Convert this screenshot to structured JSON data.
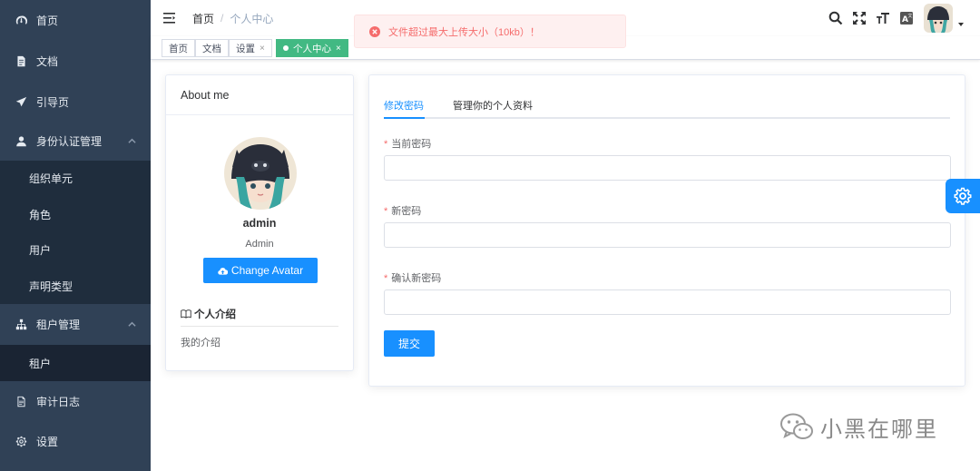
{
  "sidebar": {
    "items": [
      {
        "label": "首页",
        "icon": "dashboard-icon"
      },
      {
        "label": "文档",
        "icon": "document-icon"
      },
      {
        "label": "引导页",
        "icon": "guide-icon"
      },
      {
        "label": "身份认证管理",
        "icon": "user-icon",
        "expanded": true,
        "children": [
          "组织单元",
          "角色",
          "用户",
          "声明类型"
        ]
      },
      {
        "label": "租户管理",
        "icon": "tree-icon",
        "expanded": true,
        "children": [
          "租户"
        ]
      },
      {
        "label": "审计日志",
        "icon": "log-icon"
      },
      {
        "label": "设置",
        "icon": "gear-icon"
      }
    ]
  },
  "navbar": {
    "breadcrumb": [
      "首页",
      "个人中心"
    ],
    "icons": [
      "search-icon",
      "fullscreen-icon",
      "font-size-icon",
      "language-icon"
    ]
  },
  "tags": {
    "items": [
      {
        "label": "首页",
        "closable": false
      },
      {
        "label": "文档",
        "closable": false
      },
      {
        "label": "设置",
        "closable": true
      },
      {
        "label": "个人中心",
        "closable": true,
        "active": true
      }
    ],
    "close_symbol": "×",
    "active_color": "#42b983"
  },
  "toast": {
    "type": "error",
    "message": "文件超过最大上传大小（10kb）！",
    "color": "#f56c6c"
  },
  "about": {
    "title": "About me",
    "name": "admin",
    "role": "Admin",
    "change_avatar_label": "Change Avatar",
    "intro_title": "个人介绍",
    "intro_text": "我的介绍"
  },
  "password_form": {
    "tabs": [
      "修改密码",
      "管理你的个人资料"
    ],
    "active_tab": 0,
    "fields": [
      {
        "label": "当前密码",
        "value": "",
        "required": true
      },
      {
        "label": "新密码",
        "value": "",
        "required": true
      },
      {
        "label": "确认新密码",
        "value": "",
        "required": true
      }
    ],
    "required_mark": "*",
    "submit_label": "提交"
  },
  "watermark": {
    "text": "小黑在哪里"
  },
  "colors": {
    "sidebar_bg": "#304156",
    "submenu_bg": "#1f2d3d",
    "primary": "#1890ff",
    "error": "#f56c6c"
  }
}
